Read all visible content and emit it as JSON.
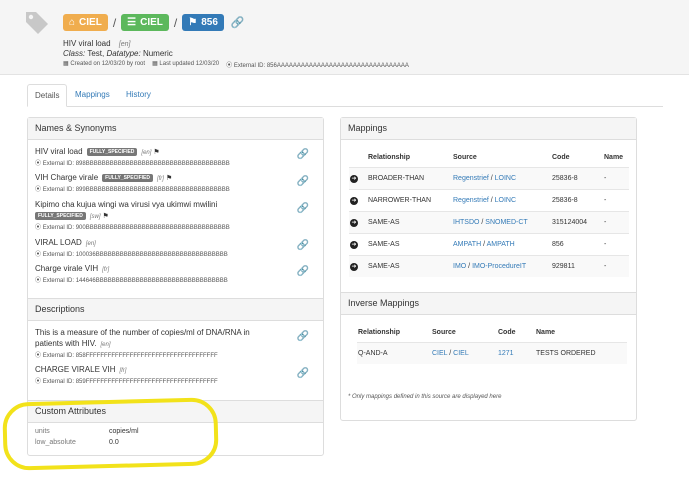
{
  "header": {
    "badges": [
      {
        "label": "CIEL",
        "icon": "home-icon",
        "color": "#f0ad4e"
      },
      {
        "label": "CIEL",
        "icon": "list-icon",
        "color": "#5cb85c"
      },
      {
        "label": "856",
        "icon": "tag-icon",
        "color": "#337ab7"
      }
    ],
    "separator": "/",
    "concept_name": "HIV viral load",
    "concept_locale": "[en]",
    "class_label": "Class:",
    "class_value": "Test,",
    "datatype_label": "Datatype:",
    "datatype_value": "Numeric",
    "created": "Created on 12/03/20 by root",
    "updated": "Last updated 12/03/20",
    "external_id": "External ID: 856AAAAAAAAAAAAAAAAAAAAAAAAAAAAAAAAA"
  },
  "tabs": [
    "Details",
    "Mappings",
    "History"
  ],
  "names_panel": {
    "title": "Names & Synonyms",
    "items": [
      {
        "name": "HIV viral load",
        "label": "FULLY_SPECIFIED",
        "locale": "[en]",
        "ext": "External ID: 898BBBBBBBBBBBBBBBBBBBBBBBBBBBBBBBBBBBB"
      },
      {
        "name": "VIH Charge virale",
        "label": "FULLY_SPECIFIED",
        "locale": "[fr]",
        "ext": "External ID: 899BBBBBBBBBBBBBBBBBBBBBBBBBBBBBBBBBBBB"
      },
      {
        "name": "Kipimo cha kujua wingi wa virusi vya ukimwi mwilini",
        "label": "FULLY_SPECIFIED",
        "locale": "[sw]",
        "ext": "External ID: 900BBBBBBBBBBBBBBBBBBBBBBBBBBBBBBBBBBBB"
      },
      {
        "name": "VIRAL LOAD",
        "label": "",
        "locale": "[en]",
        "ext": "External ID: 100036BBBBBBBBBBBBBBBBBBBBBBBBBBBBBBBBB"
      },
      {
        "name": "Charge virale VIH",
        "label": "",
        "locale": "[fr]",
        "ext": "External ID: 144646BBBBBBBBBBBBBBBBBBBBBBBBBBBBBBBBB"
      }
    ]
  },
  "descriptions_panel": {
    "title": "Descriptions",
    "items": [
      {
        "text_1": "This is a measure of the number of copies/ml of DNA/RNA in",
        "text_2": "patients with HIV.",
        "locale": "[en]",
        "ext": "External ID: 858FFFFFFFFFFFFFFFFFFFFFFFFFFFFFFFFFFFF"
      },
      {
        "text_1": "CHARGE VIRALE VIH",
        "text_2": "",
        "locale": "[fr]",
        "ext": "External ID: 859FFFFFFFFFFFFFFFFFFFFFFFFFFFFFFFFFFFF"
      }
    ]
  },
  "custom_attributes": {
    "title": "Custom Attributes",
    "rows": [
      {
        "key": "units",
        "value": "copies/ml"
      },
      {
        "key": "low_absolute",
        "value": "0.0"
      }
    ]
  },
  "mappings_panel": {
    "title": "Mappings",
    "columns": [
      "Relationship",
      "Source",
      "Code",
      "Name"
    ],
    "rows": [
      {
        "rel": "BROADER-THAN",
        "src_org": "Regenstrief",
        "src_name": "LOINC",
        "code": "25836-8",
        "name": "-"
      },
      {
        "rel": "NARROWER-THAN",
        "src_org": "Regenstrief",
        "src_name": "LOINC",
        "code": "25836-8",
        "name": "-"
      },
      {
        "rel": "SAME-AS",
        "src_org": "IHTSDO",
        "src_name": "SNOMED-CT",
        "code": "315124004",
        "name": "-"
      },
      {
        "rel": "SAME-AS",
        "src_org": "AMPATH",
        "src_name": "AMPATH",
        "code": "856",
        "name": "-"
      },
      {
        "rel": "SAME-AS",
        "src_org": "IMO",
        "src_name": "IMO-ProcedureIT",
        "code": "929811",
        "name": "-"
      }
    ]
  },
  "inverse_panel": {
    "title": "Inverse Mappings",
    "columns": [
      "Relationship",
      "Source",
      "Code",
      "Name"
    ],
    "rows": [
      {
        "rel": "Q-AND-A",
        "src_org": "CIEL",
        "src_name": "CIEL",
        "code": "1271",
        "name": "TESTS ORDERED"
      }
    ],
    "footnote": "* Only mappings defined in this source are displayed here"
  },
  "colors": {
    "link": "#337ab7",
    "highlight": "#f2e21a"
  }
}
